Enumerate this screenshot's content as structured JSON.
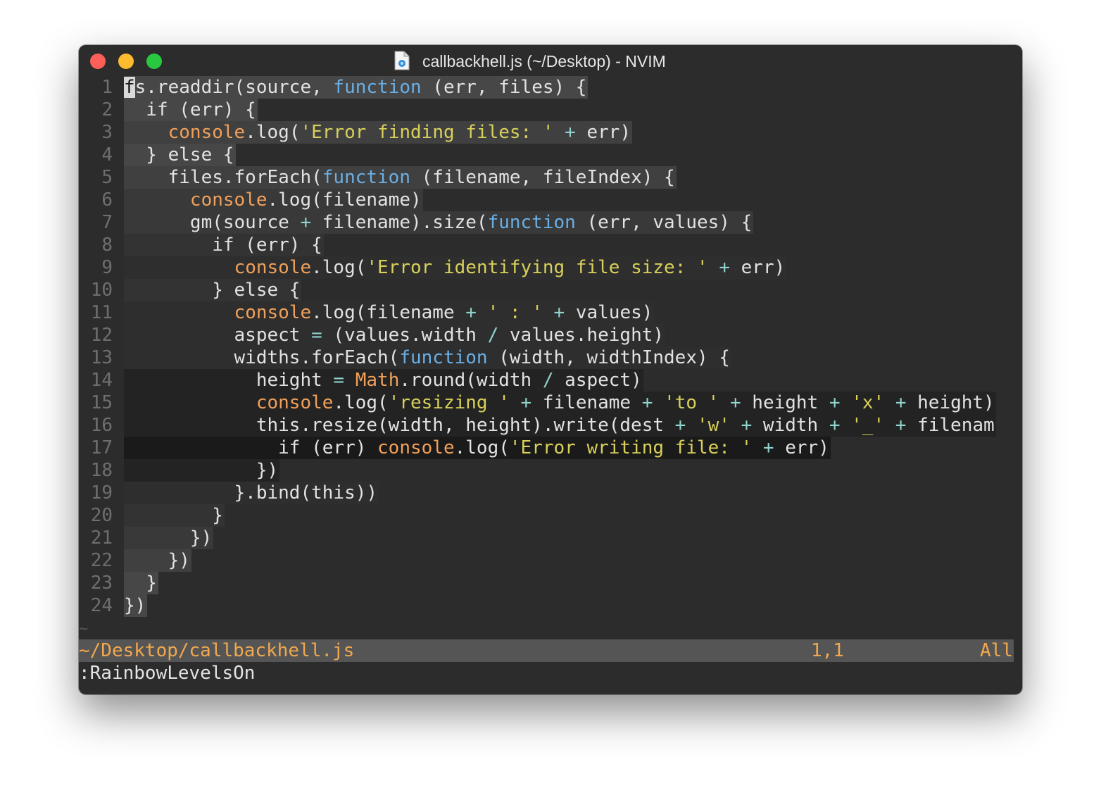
{
  "window": {
    "title": "callbackhell.js (~/Desktop) - NVIM"
  },
  "colors": {
    "keyword": "#6aaee4",
    "object": "#f0a05a",
    "string": "#d8d05a",
    "operator": "#8fd4ce",
    "status_text": "#f0a84e"
  },
  "editor": {
    "lines": [
      {
        "num": "1",
        "bg": "#474747",
        "tokens": [
          {
            "t": "f",
            "c": "cursor"
          },
          {
            "t": "s.readdir(source, "
          },
          {
            "t": "function",
            "c": "fn"
          },
          {
            "t": " (err, files) {"
          }
        ]
      },
      {
        "num": "2",
        "bg": "#474747",
        "tokens": [
          {
            "t": "  if (err) {"
          }
        ]
      },
      {
        "num": "3",
        "bg": "#404040",
        "tokens": [
          {
            "t": "    "
          },
          {
            "t": "console",
            "c": "obj"
          },
          {
            "t": ".log("
          },
          {
            "t": "'Error finding files: '",
            "c": "str"
          },
          {
            "t": " "
          },
          {
            "t": "+",
            "c": "op"
          },
          {
            "t": " err)"
          }
        ]
      },
      {
        "num": "4",
        "bg": "#474747",
        "tokens": [
          {
            "t": "  } else {"
          }
        ]
      },
      {
        "num": "5",
        "bg": "#404040",
        "tokens": [
          {
            "t": "    files.forEach("
          },
          {
            "t": "function",
            "c": "fn"
          },
          {
            "t": " (filename, fileIndex) {"
          }
        ]
      },
      {
        "num": "6",
        "bg": "#393939",
        "tokens": [
          {
            "t": "      "
          },
          {
            "t": "console",
            "c": "obj"
          },
          {
            "t": ".log(filename)"
          }
        ]
      },
      {
        "num": "7",
        "bg": "#393939",
        "tokens": [
          {
            "t": "      gm(source "
          },
          {
            "t": "+",
            "c": "op"
          },
          {
            "t": " filename).size("
          },
          {
            "t": "function",
            "c": "fn"
          },
          {
            "t": " (err, values) {"
          }
        ]
      },
      {
        "num": "8",
        "bg": "#333333",
        "tokens": [
          {
            "t": "        if (err) {"
          }
        ]
      },
      {
        "num": "9",
        "bg": "#2e2e2e",
        "tokens": [
          {
            "t": "          "
          },
          {
            "t": "console",
            "c": "obj"
          },
          {
            "t": ".log("
          },
          {
            "t": "'Error identifying file size: '",
            "c": "str"
          },
          {
            "t": " "
          },
          {
            "t": "+",
            "c": "op"
          },
          {
            "t": " err)"
          }
        ]
      },
      {
        "num": "10",
        "bg": "#333333",
        "tokens": [
          {
            "t": "        } else {"
          }
        ]
      },
      {
        "num": "11",
        "bg": "#2e2e2e",
        "tokens": [
          {
            "t": "          "
          },
          {
            "t": "console",
            "c": "obj"
          },
          {
            "t": ".log(filename "
          },
          {
            "t": "+",
            "c": "op"
          },
          {
            "t": " "
          },
          {
            "t": "' : '",
            "c": "str"
          },
          {
            "t": " "
          },
          {
            "t": "+",
            "c": "op"
          },
          {
            "t": " values)"
          }
        ]
      },
      {
        "num": "12",
        "bg": "#2e2e2e",
        "tokens": [
          {
            "t": "          aspect "
          },
          {
            "t": "=",
            "c": "op"
          },
          {
            "t": " (values.width "
          },
          {
            "t": "/",
            "c": "op"
          },
          {
            "t": " values.height)"
          }
        ]
      },
      {
        "num": "13",
        "bg": "#2e2e2e",
        "tokens": [
          {
            "t": "          widths.forEach("
          },
          {
            "t": "function",
            "c": "fn"
          },
          {
            "t": " (width, widthIndex) {"
          }
        ]
      },
      {
        "num": "14",
        "bg": "#232323",
        "tokens": [
          {
            "t": "            height "
          },
          {
            "t": "=",
            "c": "op"
          },
          {
            "t": " "
          },
          {
            "t": "Math",
            "c": "obj"
          },
          {
            "t": ".round(width "
          },
          {
            "t": "/",
            "c": "op"
          },
          {
            "t": " aspect)"
          }
        ]
      },
      {
        "num": "15",
        "bg": "#232323",
        "tokens": [
          {
            "t": "            "
          },
          {
            "t": "console",
            "c": "obj"
          },
          {
            "t": ".log("
          },
          {
            "t": "'resizing '",
            "c": "str"
          },
          {
            "t": " "
          },
          {
            "t": "+",
            "c": "op"
          },
          {
            "t": " filename "
          },
          {
            "t": "+",
            "c": "op"
          },
          {
            "t": " "
          },
          {
            "t": "'to '",
            "c": "str"
          },
          {
            "t": " "
          },
          {
            "t": "+",
            "c": "op"
          },
          {
            "t": " height "
          },
          {
            "t": "+",
            "c": "op"
          },
          {
            "t": " "
          },
          {
            "t": "'x'",
            "c": "str"
          },
          {
            "t": " "
          },
          {
            "t": "+",
            "c": "op"
          },
          {
            "t": " height)"
          }
        ]
      },
      {
        "num": "16",
        "bg": "#232323",
        "tokens": [
          {
            "t": "            this.resize(width, height).write(dest "
          },
          {
            "t": "+",
            "c": "op"
          },
          {
            "t": " "
          },
          {
            "t": "'w'",
            "c": "str"
          },
          {
            "t": " "
          },
          {
            "t": "+",
            "c": "op"
          },
          {
            "t": " width "
          },
          {
            "t": "+",
            "c": "op"
          },
          {
            "t": " "
          },
          {
            "t": "'_'",
            "c": "str"
          },
          {
            "t": " "
          },
          {
            "t": "+",
            "c": "op"
          },
          {
            "t": " filenam"
          }
        ]
      },
      {
        "num": "17",
        "bg": "#1a1a1a",
        "tokens": [
          {
            "t": "              if (err) "
          },
          {
            "t": "console",
            "c": "obj"
          },
          {
            "t": ".log("
          },
          {
            "t": "'Error writing file: '",
            "c": "str"
          },
          {
            "t": " "
          },
          {
            "t": "+",
            "c": "op"
          },
          {
            "t": " err)"
          }
        ]
      },
      {
        "num": "18",
        "bg": "#232323",
        "tokens": [
          {
            "t": "            })"
          }
        ]
      },
      {
        "num": "19",
        "bg": "#2e2e2e",
        "tokens": [
          {
            "t": "          }.bind(this))"
          }
        ]
      },
      {
        "num": "20",
        "bg": "#333333",
        "tokens": [
          {
            "t": "        }"
          }
        ]
      },
      {
        "num": "21",
        "bg": "#393939",
        "tokens": [
          {
            "t": "      })"
          }
        ]
      },
      {
        "num": "22",
        "bg": "#404040",
        "tokens": [
          {
            "t": "    })"
          }
        ]
      },
      {
        "num": "23",
        "bg": "#474747",
        "tokens": [
          {
            "t": "  }"
          }
        ]
      },
      {
        "num": "24",
        "bg": "#474747",
        "tokens": [
          {
            "t": "})"
          }
        ]
      }
    ],
    "tilde": "~"
  },
  "status": {
    "path": "~/Desktop/callbackhell.js",
    "position": "1,1",
    "scroll": "All"
  },
  "cmdline": ":RainbowLevelsOn"
}
